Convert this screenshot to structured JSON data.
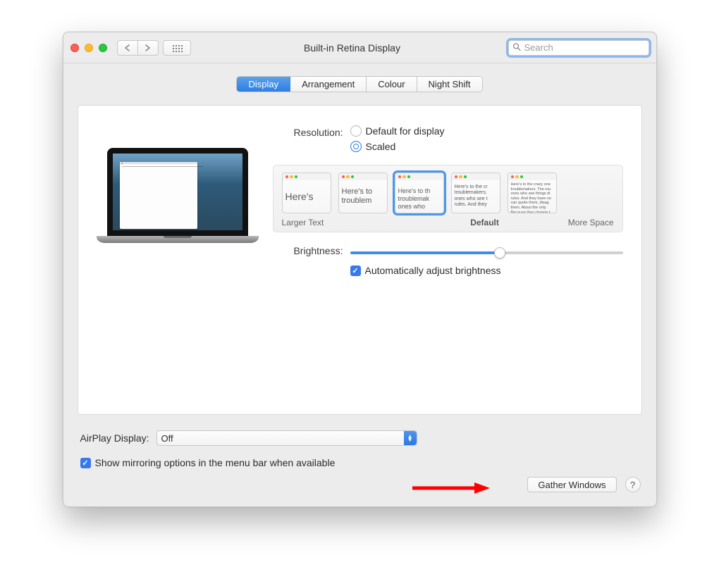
{
  "titlebar": {
    "title": "Built-in Retina Display"
  },
  "search": {
    "placeholder": "Search"
  },
  "tabs": [
    {
      "label": "Display",
      "active": true
    },
    {
      "label": "Arrangement",
      "active": false
    },
    {
      "label": "Colour",
      "active": false
    },
    {
      "label": "Night Shift",
      "active": false
    }
  ],
  "resolution": {
    "label": "Resolution:",
    "options": [
      {
        "label": "Default for display",
        "selected": false
      },
      {
        "label": "Scaled",
        "selected": true
      }
    ],
    "thumbnails": [
      {
        "text": "Here's"
      },
      {
        "text": "Here's to troublem"
      },
      {
        "text": "Here's to th troublemak ones who",
        "selected": true
      },
      {
        "text": "Here's to the cr troublemakers. ones who see t rules. And they"
      },
      {
        "text": "Here's to the crazy one troublemakers. The rou ones who see things di rules. And they have no can quote them, disag them. About the only Because they change t"
      }
    ],
    "captions": {
      "larger": "Larger Text",
      "default": "Default",
      "more": "More Space"
    }
  },
  "brightness": {
    "label": "Brightness:",
    "value_pct": 55,
    "auto_label": "Automatically adjust brightness",
    "auto_checked": true
  },
  "airplay": {
    "label": "AirPlay Display:",
    "value": "Off"
  },
  "mirroring": {
    "label": "Show mirroring options in the menu bar when available",
    "checked": true
  },
  "buttons": {
    "gather": "Gather Windows",
    "help": "?"
  }
}
